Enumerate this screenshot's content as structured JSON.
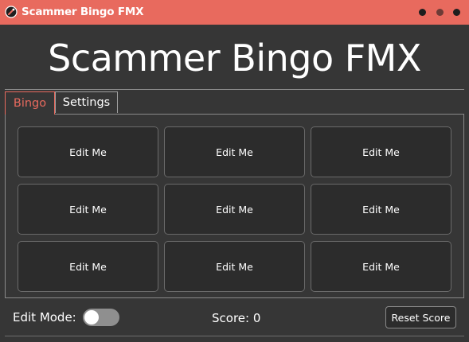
{
  "window": {
    "title": "Scammer Bingo FMX",
    "icon": "app-logo-icon",
    "accent_color": "#e86a5e"
  },
  "header": {
    "title": "Scammer Bingo FMX"
  },
  "tabs": [
    {
      "label": "Bingo",
      "active": true
    },
    {
      "label": "Settings",
      "active": false
    }
  ],
  "board": {
    "tiles": [
      {
        "label": "Edit Me"
      },
      {
        "label": "Edit Me"
      },
      {
        "label": "Edit Me"
      },
      {
        "label": "Edit Me"
      },
      {
        "label": "Edit Me"
      },
      {
        "label": "Edit Me"
      },
      {
        "label": "Edit Me"
      },
      {
        "label": "Edit Me"
      },
      {
        "label": "Edit Me"
      }
    ]
  },
  "footer": {
    "edit_mode_label": "Edit Mode:",
    "edit_mode_on": false,
    "score_text": "Score: 0",
    "reset_label": "Reset Score"
  }
}
